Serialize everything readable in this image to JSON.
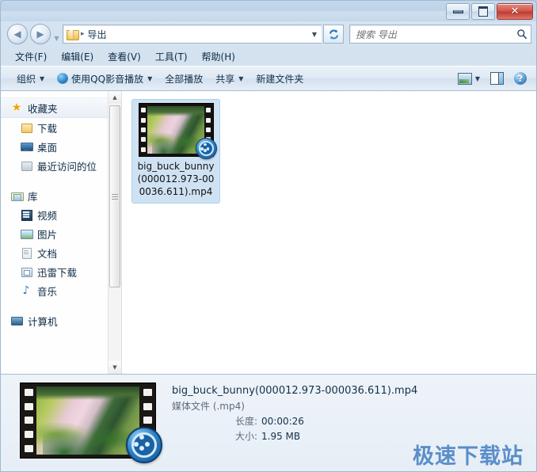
{
  "window": {
    "controls": {
      "minimize": "─",
      "maximize": "□",
      "close": "✕"
    }
  },
  "address": {
    "back_icon": "◀",
    "forward_icon": "▶",
    "history_caret": "▼",
    "folder_icon": "folder-icon",
    "separator": "▸",
    "crumb": "导出",
    "dropdown_caret": "▼",
    "refresh_icon": "↻"
  },
  "search": {
    "placeholder": "搜索 导出",
    "icon": "⌕"
  },
  "menubar": {
    "items": [
      {
        "label": "文件(F)"
      },
      {
        "label": "编辑(E)"
      },
      {
        "label": "查看(V)"
      },
      {
        "label": "工具(T)"
      },
      {
        "label": "帮助(H)"
      }
    ]
  },
  "toolbar": {
    "organize": "组织",
    "qq_play": "使用QQ影音播放",
    "play_all": "全部播放",
    "share": "共享",
    "new_folder": "新建文件夹",
    "caret": "▼",
    "help_glyph": "?"
  },
  "sidebar": {
    "groups": [
      {
        "header": {
          "label": "收藏夹",
          "icon": "star-icon"
        },
        "items": [
          {
            "label": "下载",
            "icon": "folder-icon"
          },
          {
            "label": "桌面",
            "icon": "desktop-icon"
          },
          {
            "label": "最近访问的位",
            "icon": "recent-places-icon"
          }
        ]
      },
      {
        "header": {
          "label": "库",
          "icon": "library-icon"
        },
        "items": [
          {
            "label": "视频",
            "icon": "video-icon"
          },
          {
            "label": "图片",
            "icon": "picture-icon"
          },
          {
            "label": "文档",
            "icon": "document-icon"
          },
          {
            "label": "迅雷下载",
            "icon": "thunder-download-icon"
          },
          {
            "label": "音乐",
            "icon": "music-icon"
          }
        ]
      },
      {
        "header": {
          "label": "计算机",
          "icon": "computer-icon"
        },
        "items": []
      }
    ],
    "scroll_up": "▲",
    "scroll_down": "▼"
  },
  "content": {
    "files": [
      {
        "name": "big_buck_bunny(000012.973-000036.611).mp4",
        "selected": true,
        "overlay_icon": "qq-player-badge"
      }
    ]
  },
  "details": {
    "filename": "big_buck_bunny(000012.973-000036.611).mp4",
    "filetype": "媒体文件 (.mp4)",
    "rows": [
      {
        "label": "长度:",
        "value": "00:00:26"
      },
      {
        "label": "大小:",
        "value": "1.95 MB"
      }
    ],
    "watermark": "极速下载站"
  },
  "colors": {
    "accent": "#2f86c8",
    "close_button": "#bf3b30",
    "selection": "#cfe2f3",
    "watermark": "#4f86c6"
  }
}
